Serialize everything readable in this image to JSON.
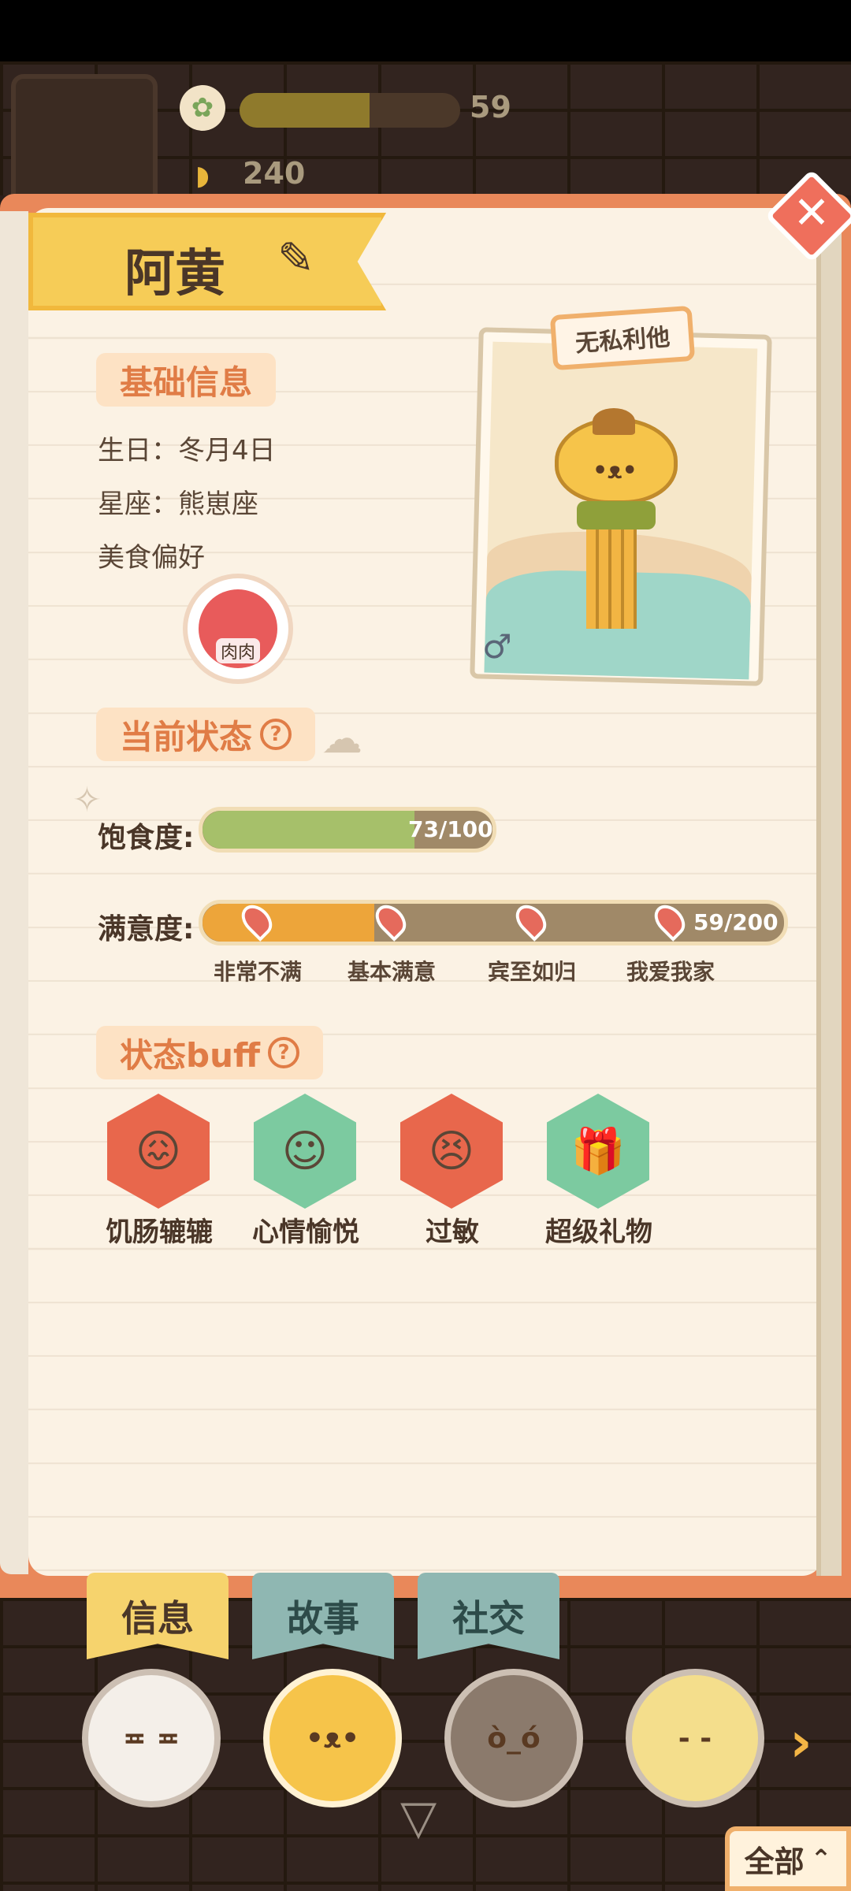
{
  "header": {
    "flower_value": "59",
    "flower_progress": 0.59,
    "banana_value": "240"
  },
  "character": {
    "name": "阿黄",
    "tag": "无私利他",
    "gender_symbol": "♂"
  },
  "basic_info": {
    "title": "基础信息",
    "birthday": "生日：冬月4日",
    "zodiac": "星座：熊崽座",
    "food_pref_label": "美食偏好",
    "food_item": "肉肉"
  },
  "status": {
    "title": "当前状态",
    "help": "?",
    "satiety_label": "饱食度:",
    "satiety_text": "73/100",
    "satiety_value": 73,
    "satiety_max": 100,
    "satisfaction_label": "满意度:",
    "satisfaction_text": "59/200",
    "satisfaction_value": 59,
    "satisfaction_max": 200,
    "milestones": [
      "非常不满",
      "基本满意",
      "宾至如归",
      "我爱我家"
    ]
  },
  "buffs": {
    "title": "状态buff",
    "help": "?",
    "items": [
      {
        "label": "饥肠辘辘",
        "icon": "hungry-icon",
        "color": "#e8674c"
      },
      {
        "label": "心情愉悦",
        "icon": "happy-icon",
        "color": "#7ccaa0"
      },
      {
        "label": "过敏",
        "icon": "allergy-icon",
        "color": "#e8674c"
      },
      {
        "label": "超级礼物",
        "icon": "gift-icon",
        "color": "#7ccaa0"
      }
    ]
  },
  "tabs": [
    {
      "label": "信息",
      "active": true
    },
    {
      "label": "故事",
      "active": false
    },
    {
      "label": "社交",
      "active": false
    }
  ],
  "bottom": {
    "all_label": "全部"
  },
  "colors": {
    "accent": "#e07c46",
    "panel_border": "#e9885a",
    "satiety_fill": "#a6c06a",
    "satisfaction_fill": "#eda53a"
  }
}
